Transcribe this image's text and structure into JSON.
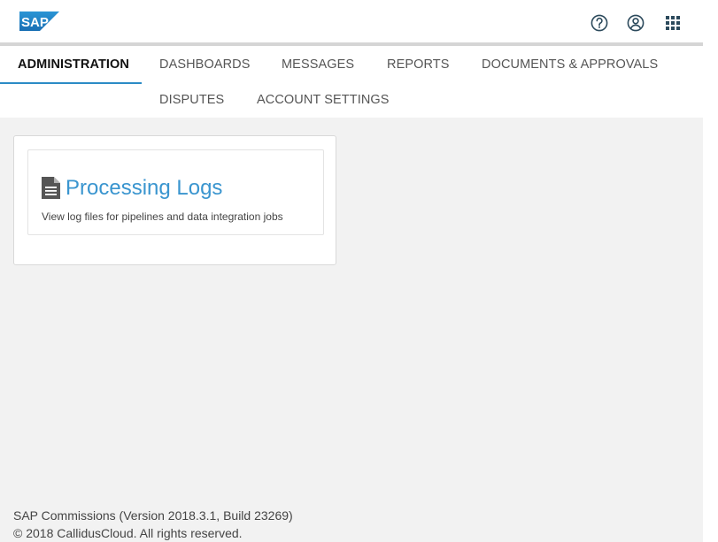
{
  "brand": {
    "logo_text": "SAP",
    "logo_color": "#1a6fb4"
  },
  "header": {
    "icons": [
      "help-icon",
      "user-icon",
      "apps-grid-icon"
    ]
  },
  "nav": {
    "items": [
      {
        "label": "ADMINISTRATION",
        "active": true
      },
      {
        "label": "DASHBOARDS"
      },
      {
        "label": "MESSAGES"
      },
      {
        "label": "REPORTS"
      },
      {
        "label": "DOCUMENTS & APPROVALS"
      },
      {
        "label": "DISPUTES"
      },
      {
        "label": "ACCOUNT SETTINGS"
      }
    ],
    "accent": "#2b8bc6"
  },
  "main": {
    "card": {
      "icon": "document-icon",
      "title": "Processing Logs",
      "description": "View log files for pipelines and data integration jobs"
    }
  },
  "footer": {
    "version": "SAP Commissions (Version 2018.3.1, Build 23269)",
    "copyright": "© 2018 CallidusCloud. All rights reserved."
  }
}
